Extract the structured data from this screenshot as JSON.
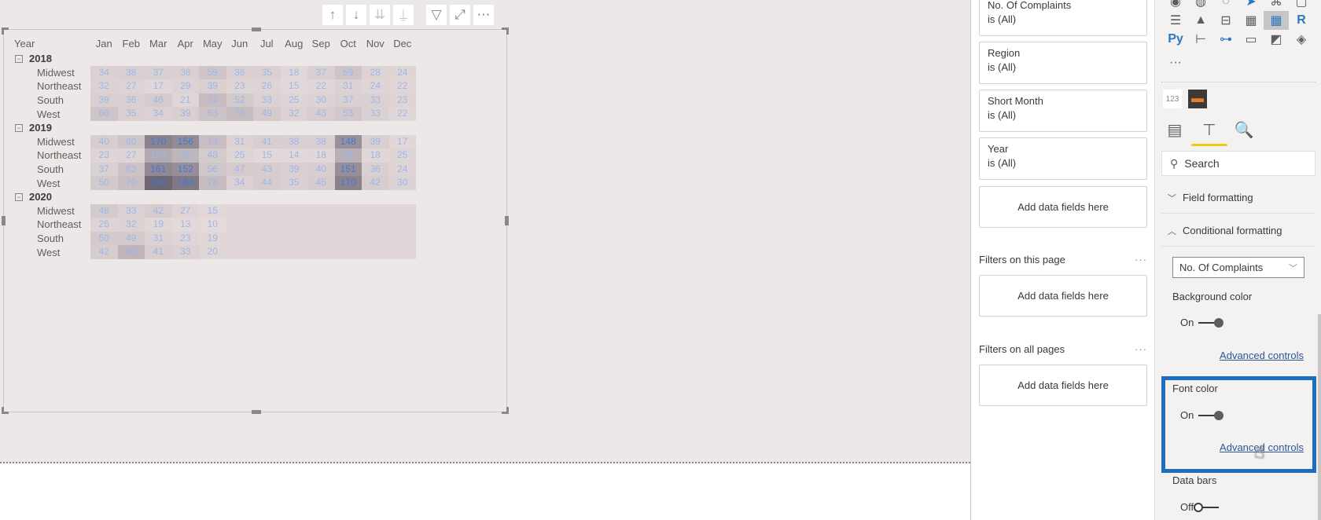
{
  "visual_toolbar": {
    "buttons": [
      {
        "name": "drill-up-icon",
        "glyph": "↑",
        "enabled": true
      },
      {
        "name": "drill-down-icon",
        "glyph": "↓",
        "enabled": true
      },
      {
        "name": "go-to-next-level-icon",
        "glyph": "⇊",
        "enabled": false
      },
      {
        "name": "expand-hierarchy-icon",
        "glyph": "⍊",
        "enabled": false
      },
      {
        "name": "filter-icon",
        "glyph": "▽",
        "enabled": true
      },
      {
        "name": "focus-mode-icon",
        "glyph": "⤢",
        "enabled": true
      },
      {
        "name": "more-options-icon",
        "glyph": "⋯",
        "enabled": true
      }
    ]
  },
  "matrix": {
    "row_header_title": "Year",
    "columns": [
      "Jan",
      "Feb",
      "Mar",
      "Apr",
      "May",
      "Jun",
      "Jul",
      "Aug",
      "Sep",
      "Oct",
      "Nov",
      "Dec"
    ],
    "expand_glyph": "⊟",
    "groups": [
      {
        "year": "2018",
        "rows": [
          {
            "region": "Midwest",
            "values": [
              34,
              38,
              37,
              36,
              59,
              36,
              35,
              18,
              37,
              59,
              28,
              24
            ]
          },
          {
            "region": "Northeast",
            "values": [
              32,
              27,
              17,
              29,
              39,
              23,
              26,
              15,
              22,
              31,
              24,
              22
            ]
          },
          {
            "region": "South",
            "values": [
              39,
              36,
              46,
              21,
              74,
              52,
              33,
              25,
              30,
              37,
              33,
              23
            ]
          },
          {
            "region": "West",
            "values": [
              60,
              35,
              34,
              39,
              63,
              75,
              49,
              32,
              43,
              53,
              33,
              22
            ]
          }
        ]
      },
      {
        "year": "2019",
        "rows": [
          {
            "region": "Midwest",
            "values": [
              40,
              60,
              170,
              156,
              73,
              31,
              41,
              38,
              38,
              148,
              39,
              17
            ]
          },
          {
            "region": "Northeast",
            "values": [
              23,
              27,
              109,
              88,
              48,
              25,
              15,
              14,
              18,
              98,
              18,
              25
            ]
          },
          {
            "region": "South",
            "values": [
              37,
              63,
              161,
              152,
              56,
              47,
              43,
              39,
              40,
              151,
              36,
              24
            ]
          },
          {
            "region": "West",
            "values": [
              50,
              70,
              210,
              184,
              78,
              34,
              44,
              35,
              45,
              170,
              42,
              30
            ]
          }
        ]
      },
      {
        "year": "2020",
        "rows": [
          {
            "region": "Midwest",
            "values": [
              48,
              33,
              42,
              27,
              15,
              null,
              null,
              null,
              null,
              null,
              null,
              null
            ]
          },
          {
            "region": "Northeast",
            "values": [
              26,
              32,
              19,
              13,
              10,
              null,
              null,
              null,
              null,
              null,
              null,
              null
            ]
          },
          {
            "region": "South",
            "values": [
              50,
              49,
              31,
              23,
              19,
              null,
              null,
              null,
              null,
              null,
              null,
              null
            ]
          },
          {
            "region": "West",
            "values": [
              42,
              89,
              41,
              33,
              20,
              null,
              null,
              null,
              null,
              null,
              null,
              null
            ]
          }
        ]
      }
    ],
    "colors": {
      "min_bg": "#e6dcdc",
      "max_bg": "#6e6575",
      "font": "#9db7e8",
      "font_max": "#3f7bd6"
    }
  },
  "filters_pane": {
    "visual_filters": [
      {
        "field": "No. Of Complaints",
        "state": "is (All)"
      },
      {
        "field": "Region",
        "state": "is (All)"
      },
      {
        "field": "Short Month",
        "state": "is (All)"
      },
      {
        "field": "Year",
        "state": "is (All)"
      }
    ],
    "add_fields_label": "Add data fields here",
    "page_filters_title": "Filters on this page",
    "all_pages_filters_title": "Filters on all pages",
    "more_glyph": "···"
  },
  "visualizations_pane": {
    "icon_rows": [
      [
        "map-icon",
        "filled-map-icon",
        "shape-map-icon",
        "azure-map-icon",
        "key-influencers-icon",
        "image-icon"
      ],
      [
        "card-icon",
        "kpi-icon",
        "slicer-icon",
        "table-icon",
        "matrix-icon",
        "r-visual-icon"
      ],
      [
        "python-visual-icon",
        "decomposition-tree-icon",
        "qa-icon",
        "smart-narrative-icon",
        "power-apps-icon",
        "power-automate-icon"
      ]
    ],
    "icon_glyphs": [
      [
        "◉",
        "◍",
        "◌",
        "➤",
        "⌘",
        "▢"
      ],
      [
        "☰",
        "▲",
        "⊟",
        "▦",
        "▦",
        "R"
      ],
      [
        "Py",
        "⊢",
        "⊶",
        "▭",
        "◩",
        "◈"
      ]
    ],
    "more_visuals": "···",
    "custom_visuals": [
      "123",
      "▬"
    ],
    "tabs": [
      {
        "name": "fields-tab",
        "glyph": "▤"
      },
      {
        "name": "format-tab",
        "glyph": "🖌"
      },
      {
        "name": "analytics-tab",
        "glyph": "🔍"
      }
    ],
    "search_placeholder": "Search",
    "sections": {
      "field_formatting": "Field formatting",
      "conditional_formatting": "Conditional formatting"
    },
    "measure_dropdown": "No. Of Complaints",
    "background_color": {
      "label": "Background color",
      "state": "On"
    },
    "font_color": {
      "label": "Font color",
      "state": "On"
    },
    "data_bars": {
      "label": "Data bars",
      "state": "Off"
    },
    "advanced_controls": "Advanced controls",
    "accent_highlight": "#1b6ec2"
  }
}
